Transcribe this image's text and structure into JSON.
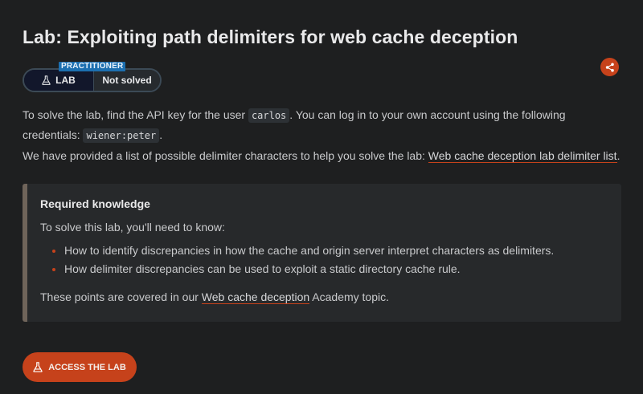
{
  "lab": {
    "title": "Lab: Exploiting path delimiters for web cache deception",
    "level": "PRACTITIONER",
    "badge_label": "LAB",
    "status": "Not solved",
    "share_icon": "share-icon",
    "flask_icon": "flask-icon"
  },
  "description": {
    "p1_before": "To solve the lab, find the API key for the user ",
    "p1_user": "carlos",
    "p1_middle": ". You can log in to your own account using the following credentials: ",
    "p1_credentials": "wiener:peter",
    "p1_end": ".",
    "p2_before": "We have provided a list of possible delimiter characters to help you solve the lab: ",
    "p2_link": "Web cache deception lab delimiter list",
    "p2_end": "."
  },
  "knowledge": {
    "title": "Required knowledge",
    "intro": "To solve this lab, you'll need to know:",
    "items": [
      "How to identify discrepancies in how the cache and origin server interpret characters as delimiters.",
      "How delimiter discrepancies can be used to exploit a static directory cache rule."
    ],
    "outro_before": "These points are covered in our ",
    "outro_link": "Web cache deception",
    "outro_after": " Academy topic."
  },
  "actions": {
    "access_label": "ACCESS THE LAB"
  },
  "colors": {
    "accent": "#c6421b",
    "background": "#1e1f20",
    "level_tag": "#1c6fb0"
  }
}
